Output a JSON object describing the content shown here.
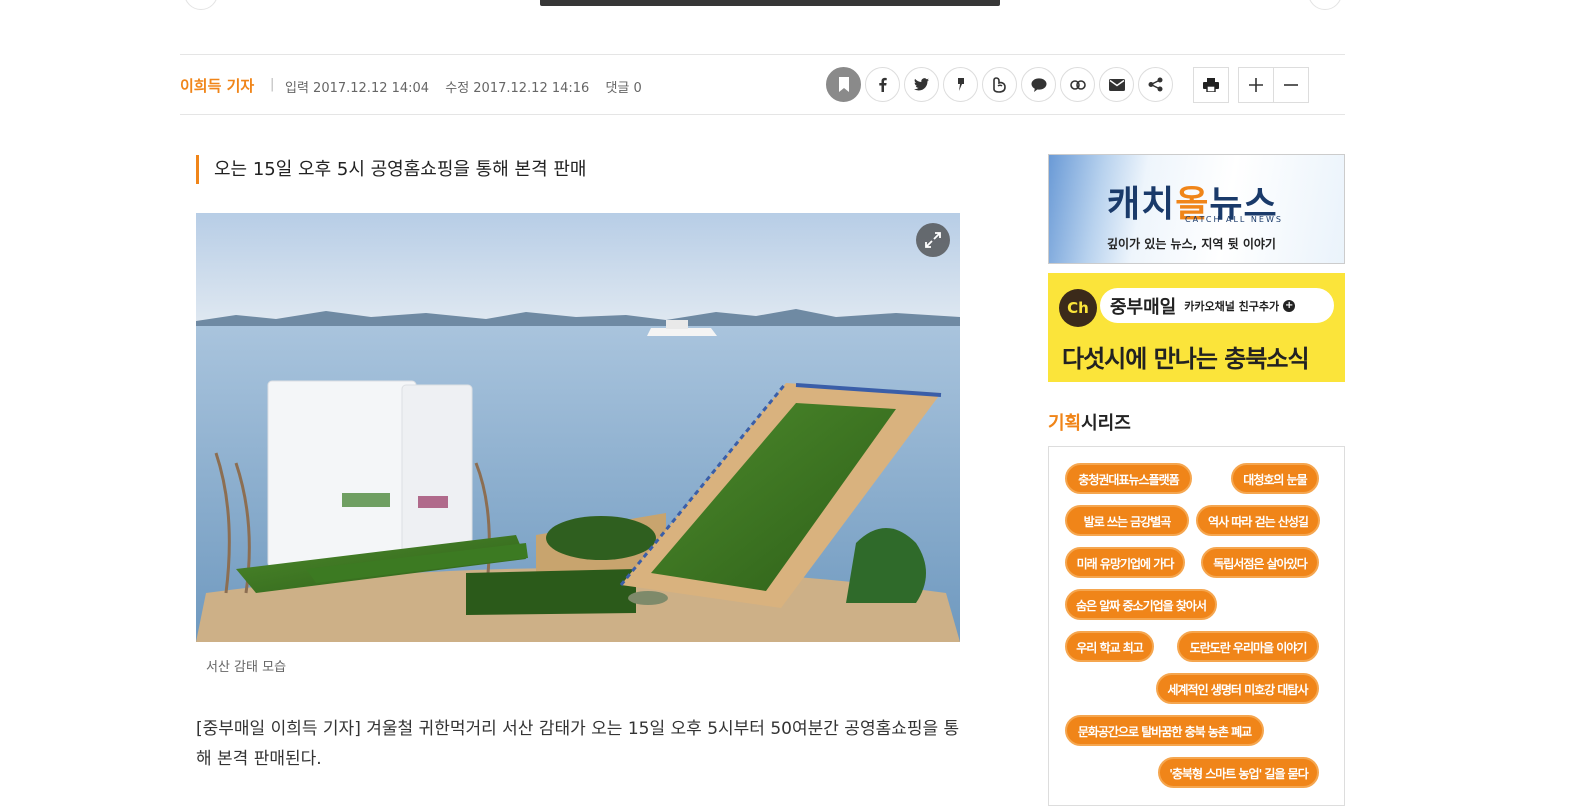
{
  "article": {
    "reporter": "이희득 기자",
    "separator": "|",
    "input_time": "입력 2017.12.12 14:04",
    "modified_time": "수정 2017.12.12 14:16",
    "comments": "댓글 0",
    "subtitle": "오는 15일 오후 5시 공영홈쇼핑을 통해 본격 판매",
    "photo_caption": "서산 감태 모습",
    "body_text": "[중부매일 이희득 기자] 겨울철 귀한먹거리 서산 감태가 오는 15일 오후 5시부터 50여분간 공영홈쇼핑을 통해 본격 판매된다."
  },
  "share_icons": [
    "bookmark-icon",
    "facebook-icon",
    "twitter-icon",
    "kakaostory-icon",
    "band-icon",
    "kakaotalk-icon",
    "link-icon",
    "email-icon",
    "share-icon"
  ],
  "tool_icons": [
    "print-icon",
    "font-increase-icon",
    "font-decrease-icon"
  ],
  "banners": {
    "catchall": {
      "logo_pre": "캐치",
      "logo_o": "올",
      "logo_post": "뉴스",
      "en": "CATCH ALL NEWS",
      "slogan": "깊이가 있는 뉴스, 지역 뒷 이야기"
    },
    "kakao": {
      "ch": "Ch",
      "name": "중부매일",
      "cta": "카카오채널 친구추가",
      "plus": "+",
      "headline": "다섯시에 만나는 충북소식"
    }
  },
  "series": {
    "title_highlight": "기획",
    "title_rest": "시리즈",
    "tags": [
      "충청권대표뉴스플랫폼",
      "대청호의 눈물",
      "발로 쓰는 금강별곡",
      "역사 따라 걷는 산성길",
      "미래 유망기업에 가다",
      "독립서점은 살아있다",
      "숨은 알짜 중소기업을 찾아서",
      "우리 학교 최고",
      "도란도란 우리마을 이야기",
      "세계적인 생명터 미호강 대탐사",
      "문화공간으로 탈바꿈한 충북 농촌 폐교",
      "'충북형 스마트 농업' 길을 묻다"
    ]
  },
  "colors": {
    "accent": "#f08519",
    "kakao_yellow": "#fbe43a"
  }
}
